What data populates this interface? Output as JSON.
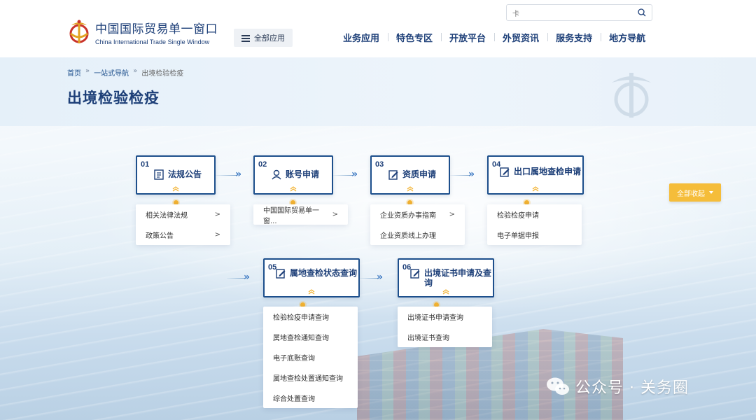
{
  "header": {
    "logo_cn": "中国国际贸易单一窗口",
    "logo_en": "China International Trade Single Window",
    "all_apps_label": "全部应用",
    "search_value": "卡",
    "nav": [
      "业务应用",
      "特色专区",
      "开放平台",
      "外贸资讯",
      "服务支持",
      "地方导航"
    ]
  },
  "breadcrumb": {
    "home": "首页",
    "sep": "»",
    "level1": "一站式导航",
    "current": "出境检验检疫"
  },
  "page_title": "出境检验检疫",
  "steps": [
    {
      "num": "01",
      "title": "法规公告",
      "icon": "document-icon",
      "items": [
        {
          "label": "相关法律法规",
          "arrow": ">"
        },
        {
          "label": "政策公告",
          "arrow": ">"
        }
      ]
    },
    {
      "num": "02",
      "title": "账号申请",
      "icon": "user-icon",
      "items": [
        {
          "label": "中国国际贸易单一窗...",
          "arrow": ">"
        }
      ]
    },
    {
      "num": "03",
      "title": "资质申请",
      "icon": "edit-icon",
      "items": [
        {
          "label": "企业资质办事指南",
          "arrow": ">"
        },
        {
          "label": "企业资质线上办理",
          "arrow": ""
        }
      ]
    },
    {
      "num": "04",
      "title": "出口属地查检申请",
      "icon": "edit-icon",
      "items": [
        {
          "label": "检验检疫申请",
          "arrow": ""
        },
        {
          "label": "电子单据申报",
          "arrow": ""
        }
      ]
    },
    {
      "num": "05",
      "title": "属地查检状态查询",
      "icon": "edit-icon",
      "items": [
        {
          "label": "检验检疫申请查询",
          "arrow": ""
        },
        {
          "label": "属地查检通知查询",
          "arrow": ""
        },
        {
          "label": "电子底账查询",
          "arrow": ""
        },
        {
          "label": "属地查检处置通知查询",
          "arrow": ""
        },
        {
          "label": "综合处置查询",
          "arrow": ""
        }
      ]
    },
    {
      "num": "06",
      "title": "出境证书申请及查询",
      "icon": "edit-icon",
      "items": [
        {
          "label": "出境证书申请查询",
          "arrow": ""
        },
        {
          "label": "出境证书查询",
          "arrow": ""
        }
      ]
    }
  ],
  "flow_arrow": "»",
  "collapse_label": "全部收起",
  "watermark_text": "公众号 · 关务圈",
  "colors": {
    "primary": "#1d3f78",
    "accent": "#f5bd3a",
    "dot": "#f2b232"
  }
}
